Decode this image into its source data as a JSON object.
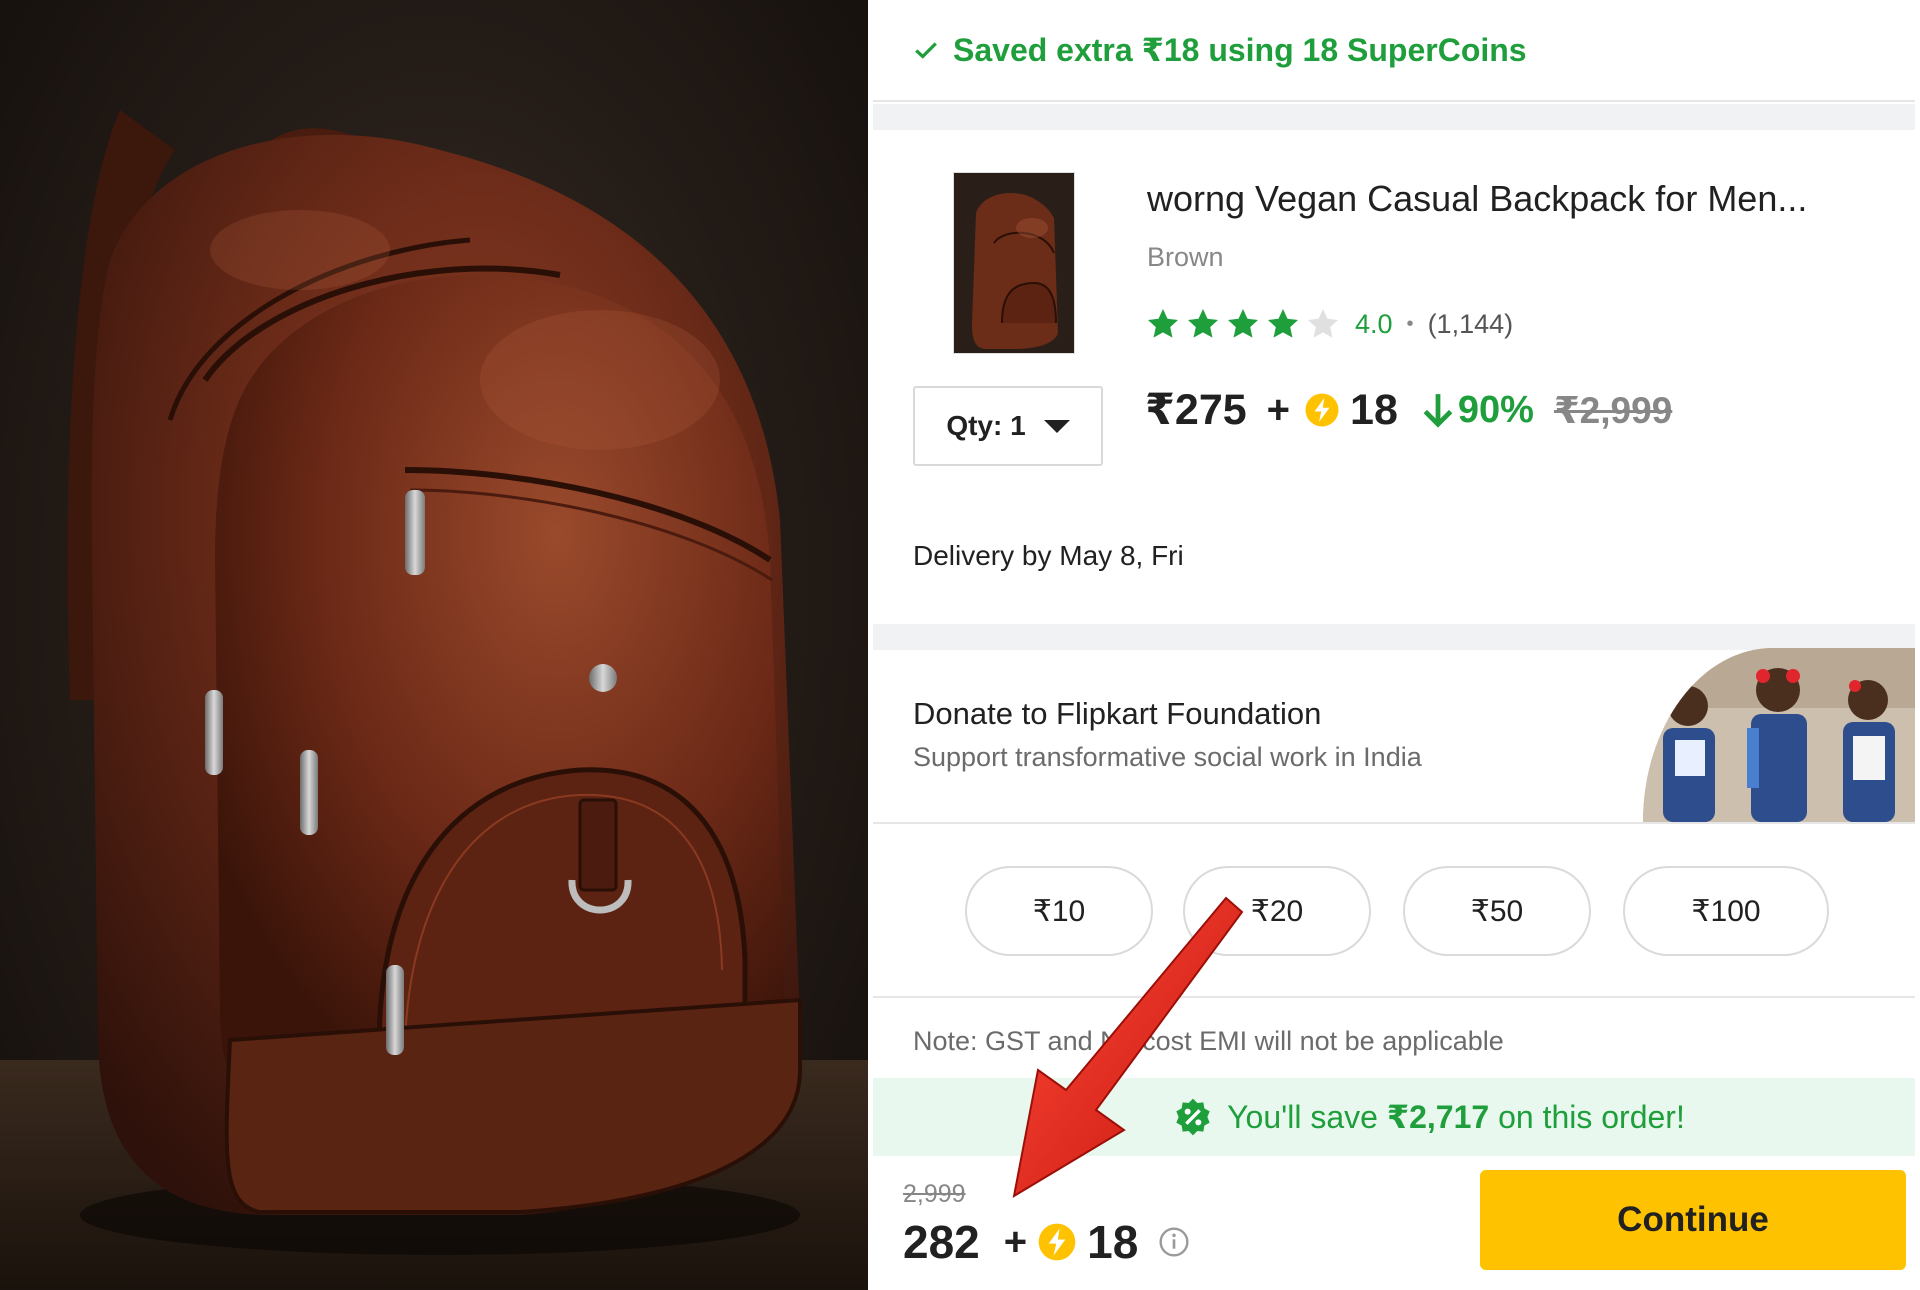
{
  "photo": {
    "alt": "Brown leather backpack"
  },
  "savings_top": {
    "text": "Saved extra ₹18 using 18 SuperCoins",
    "icon": "check-icon",
    "color": "#1f9e3c"
  },
  "product": {
    "title": "worng Vegan Casual Backpack for Men...",
    "color": "Brown",
    "rating": "4.0",
    "rating_stars": 4,
    "rating_stars_total": 5,
    "rating_count": "(1,144)",
    "price": "₹275",
    "plus": "+",
    "supercoins": "18",
    "discount": "90%",
    "mrp": "₹2,999",
    "qty_label": "Qty: 1"
  },
  "delivery": {
    "text": "Delivery by May 8, Fri"
  },
  "donate": {
    "title": "Donate to Flipkart Foundation",
    "subtitle": "Support transformative social work in India",
    "amounts": [
      "₹10",
      "₹20",
      "₹50",
      "₹100"
    ]
  },
  "note": {
    "text": "Note: GST and No cost EMI will not be applicable"
  },
  "save_banner": {
    "prefix": "You'll save ",
    "amount": "₹2,717",
    "suffix": " on this order!",
    "icon": "percent-badge-icon"
  },
  "footer": {
    "mrp": "2,999",
    "price": "282",
    "plus": "+",
    "supercoins": "18",
    "continue_label": "Continue"
  },
  "colors": {
    "green": "#1f9e3c",
    "yellow": "#ffc200",
    "red_arrow": "#e1261c",
    "star_green": "#1f9e3c",
    "star_empty": "#e0e0e0"
  }
}
